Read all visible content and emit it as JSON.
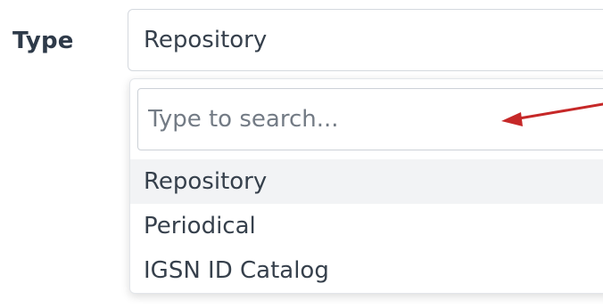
{
  "field": {
    "label": "Type",
    "selected_value": "Repository"
  },
  "dropdown": {
    "search_placeholder": "Type to search...",
    "search_value": "",
    "options": [
      {
        "label": "Repository",
        "highlighted": true
      },
      {
        "label": "Periodical",
        "highlighted": false
      },
      {
        "label": "IGSN ID Catalog",
        "highlighted": false
      }
    ]
  },
  "annotation": {
    "arrow_color": "#c62828",
    "arrow_target": "search-input"
  },
  "colors": {
    "text": "#36404c",
    "label": "#2e3a49",
    "highlight": "#f2f3f5",
    "border": "#d4d8de"
  }
}
